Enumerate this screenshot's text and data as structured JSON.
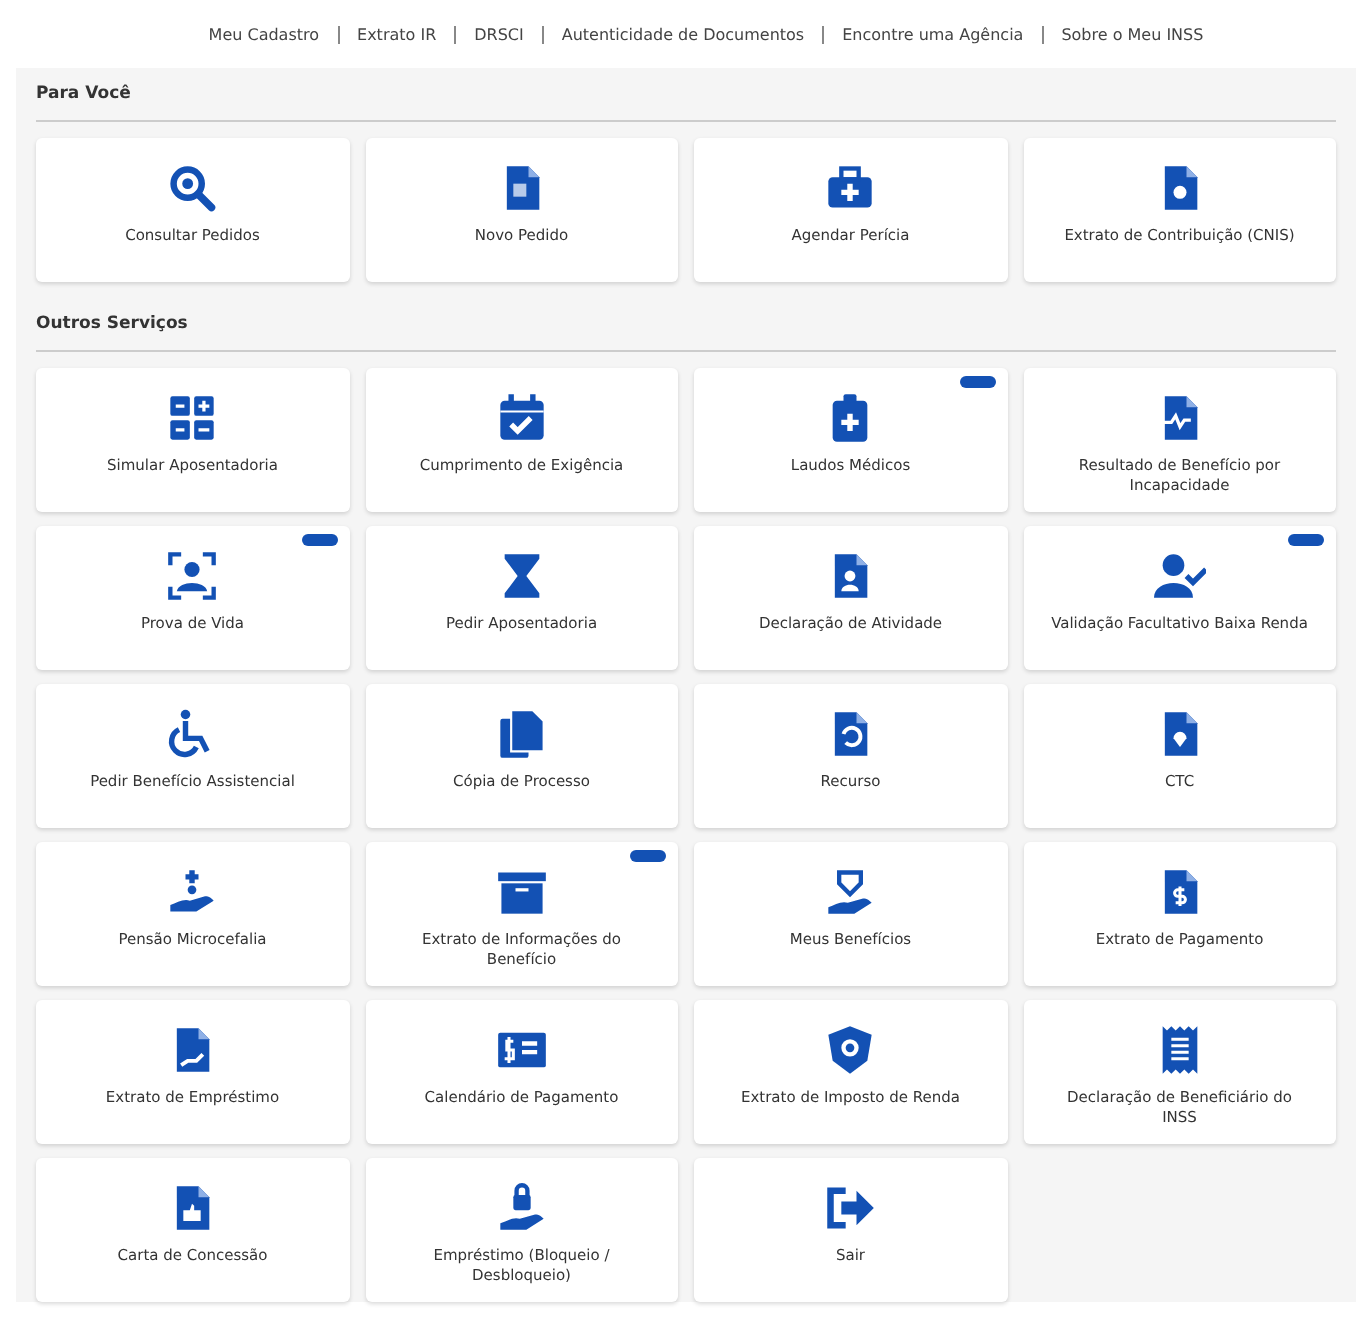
{
  "top_links": [
    "Meu Cadastro",
    "Extrato IR",
    "DRSCI",
    "Autenticidade de Documentos",
    "Encontre uma Agência",
    "Sobre o Meu INSS"
  ],
  "sections": [
    {
      "title": "Para Você",
      "tiles": [
        {
          "label": "Consultar Pedidos",
          "badge": false
        },
        {
          "label": "Novo Pedido",
          "badge": false
        },
        {
          "label": "Agendar Perícia",
          "badge": false
        },
        {
          "label": "Extrato de Contribuição (CNIS)",
          "badge": false
        }
      ]
    },
    {
      "title": "Outros Serviços",
      "tiles": [
        {
          "label": "Simular Aposentadoria",
          "badge": false
        },
        {
          "label": "Cumprimento de Exigência",
          "badge": false
        },
        {
          "label": "Laudos Médicos",
          "badge": true
        },
        {
          "label": "Resultado de Benefício por Incapacidade",
          "badge": false
        },
        {
          "label": "Prova de Vida",
          "badge": true
        },
        {
          "label": "Pedir Aposentadoria",
          "badge": false
        },
        {
          "label": "Declaração de Atividade",
          "badge": false
        },
        {
          "label": "Validação Facultativo Baixa Renda",
          "badge": true
        },
        {
          "label": "Pedir Benefício Assistencial",
          "badge": false
        },
        {
          "label": "Cópia de Processo",
          "badge": false
        },
        {
          "label": "Recurso",
          "badge": false
        },
        {
          "label": "CTC",
          "badge": false
        },
        {
          "label": "Pensão Microcefalia",
          "badge": false
        },
        {
          "label": "Extrato de Informações do Benefício",
          "badge": true
        },
        {
          "label": "Meus Benefícios",
          "badge": false
        },
        {
          "label": "Extrato de Pagamento",
          "badge": false
        },
        {
          "label": "Extrato de Empréstimo",
          "badge": false
        },
        {
          "label": "Calendário de Pagamento",
          "badge": false
        },
        {
          "label": "Extrato de Imposto de Renda",
          "badge": false
        },
        {
          "label": "Declaração de Beneficiário do INSS",
          "badge": false
        },
        {
          "label": "Carta de Concessão",
          "badge": false
        },
        {
          "label": "Empréstimo (Bloqueio / Desbloqueio)",
          "badge": false
        },
        {
          "label": "Sair",
          "badge": false
        }
      ]
    }
  ]
}
